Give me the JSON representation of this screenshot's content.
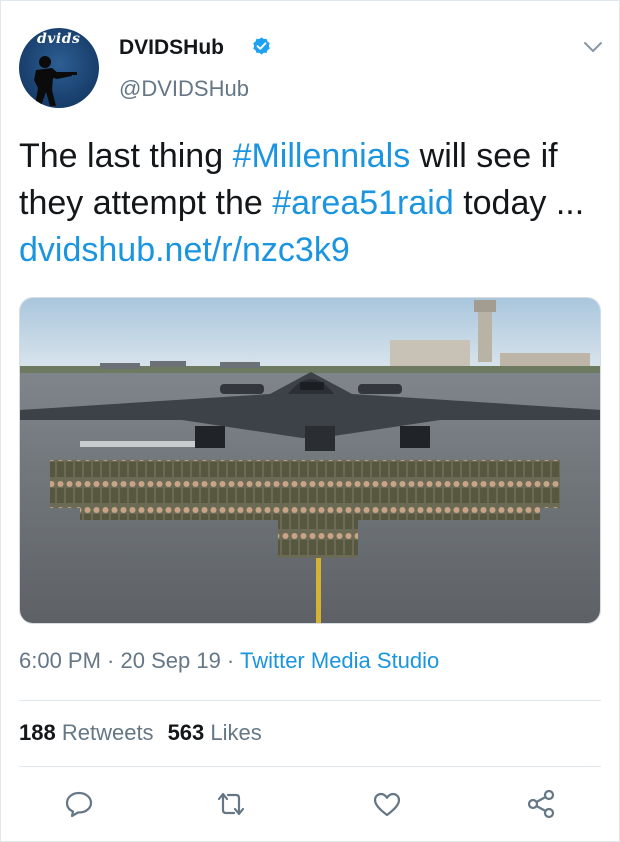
{
  "author": {
    "name": "DVIDSHub",
    "handle": "@DVIDSHub",
    "avatar_text": "dvids",
    "verified": true
  },
  "tweet": {
    "text_1": "The last thing ",
    "hashtag_1": "#Millennials",
    "text_2": " will see if they attempt the ",
    "hashtag_2": "#area51raid",
    "text_3": " today ... ",
    "link": "dvidshub.net/r/nzc3k9"
  },
  "meta": {
    "time": "6:00 PM",
    "sep_1": " · ",
    "date": "20 Sep 19",
    "sep_2": " · ",
    "source": "Twitter Media Studio"
  },
  "stats": {
    "retweets_count": "188",
    "retweets_label": "Retweets",
    "likes_count": "563",
    "likes_label": "Likes"
  },
  "actions": [
    "reply-icon",
    "retweet-icon",
    "like-icon",
    "share-icon"
  ],
  "colors": {
    "link": "#1b95e0",
    "secondary_text": "#657786",
    "primary_text": "#14171a",
    "divider": "#e1e8ed"
  }
}
